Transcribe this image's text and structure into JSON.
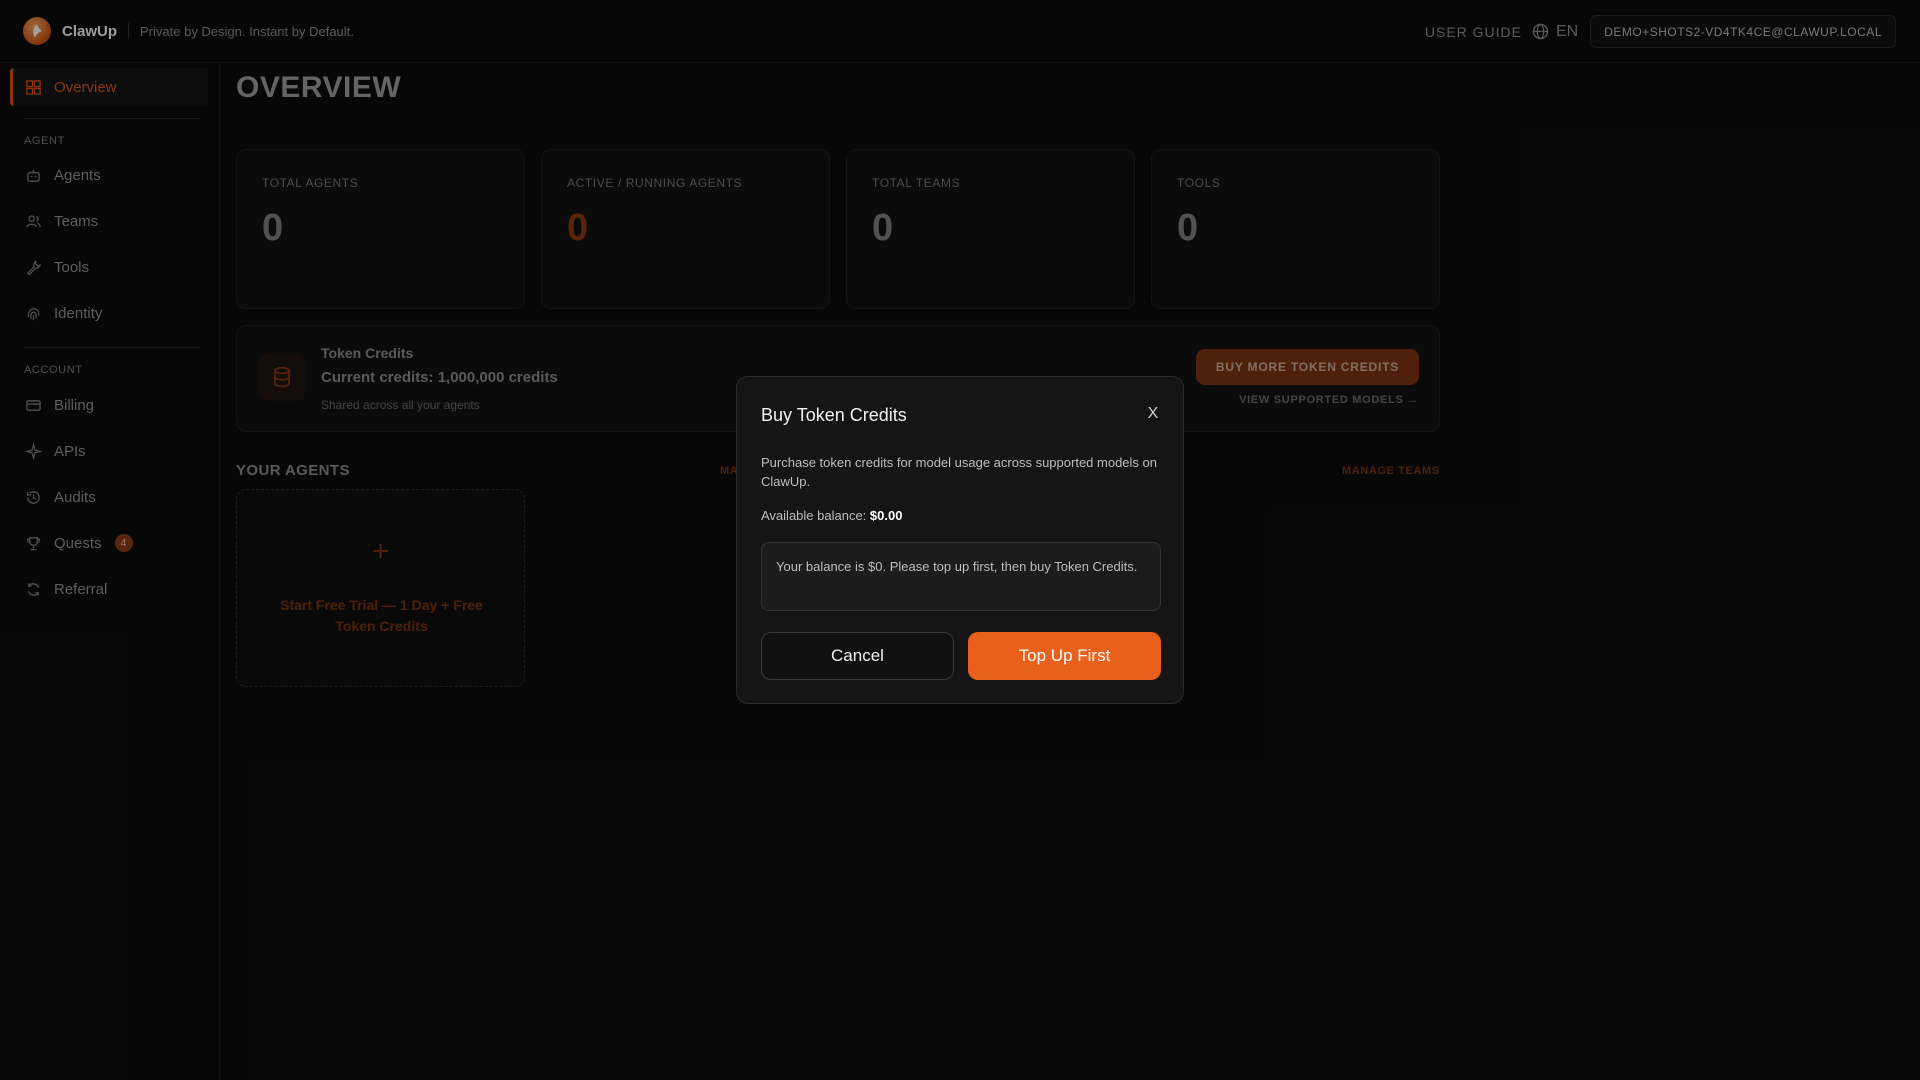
{
  "header": {
    "app_name": "ClawUp",
    "tagline": "Private by Design. Instant by Default.",
    "user_guide": "USER GUIDE",
    "language": "EN",
    "user_email": "DEMO+SHOTS2-VD4TK4CE@CLAWUP.LOCAL"
  },
  "sidebar": {
    "overview": "Overview",
    "agent_section": "AGENT",
    "agent_items": [
      "Agents",
      "Teams",
      "Tools",
      "Identity"
    ],
    "account_section": "ACCOUNT",
    "account_items": [
      "Billing",
      "APIs",
      "Audits",
      "Quests",
      "Referral"
    ],
    "quests_badge": "4"
  },
  "main": {
    "title": "OVERVIEW",
    "stats": [
      {
        "label": "TOTAL AGENTS",
        "value": "0"
      },
      {
        "label": "ACTIVE / RUNNING AGENTS",
        "value": "0"
      },
      {
        "label": "TOTAL TEAMS",
        "value": "0"
      },
      {
        "label": "TOOLS",
        "value": "0"
      }
    ],
    "credits": {
      "title": "Token Credits",
      "current": "Current credits: 1,000,000 credits",
      "note": "Shared across all your agents",
      "buy_button": "BUY MORE TOKEN CREDITS",
      "view_models": "VIEW SUPPORTED MODELS →"
    },
    "your_agents": "YOUR AGENTS",
    "manage_agents": "MA",
    "manage_teams": "MANAGE TEAMS",
    "trial_plus": "+",
    "trial_text": "Start Free Trial — 1 Day + Free Token Credits"
  },
  "modal": {
    "title": "Buy Token Credits",
    "close": "X",
    "description": "Purchase token credits for model usage across supported models on ClawUp.",
    "balance_label": "Available balance:",
    "balance_value": "$0.00",
    "notice": "Your balance is $0. Please top up first, then buy Token Credits.",
    "cancel": "Cancel",
    "confirm": "Top Up First"
  },
  "colors": {
    "accent": "#e8601c",
    "background": "#0c0c0c"
  }
}
